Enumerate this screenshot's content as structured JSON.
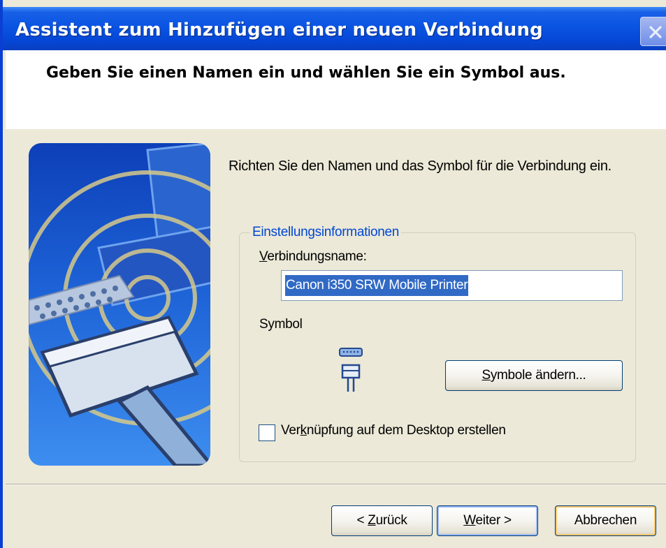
{
  "window": {
    "title": "Assistent zum Hinzufügen einer neuen Verbindung"
  },
  "header": {
    "title": "Geben Sie einen Namen ein und wählen Sie ein Symbol aus."
  },
  "main": {
    "intro": "Richten Sie den Namen und das Symbol für die Verbindung ein.",
    "group": {
      "legend": "Einstellungsinformationen",
      "name_label_mnemonic": "V",
      "name_label_rest": "erbindungsname:",
      "name_value": "Canon i350 SRW Mobile Printer",
      "symbol_label": "Symbol",
      "symbol_icon": "serial-port-connector-icon",
      "change_symbols_mnemonic": "S",
      "change_symbols_rest": "ymbole ändern...",
      "shortcut_label_pre": "Ver",
      "shortcut_label_mnemonic": "k",
      "shortcut_label_rest": "nüpfung auf dem Desktop erstellen",
      "shortcut_checked": false
    }
  },
  "footer": {
    "back_pre": "< ",
    "back_mnemonic": "Z",
    "back_rest": "urück",
    "next_mnemonic": "W",
    "next_rest": "eiter >",
    "cancel": "Abbrechen"
  },
  "colors": {
    "titlebar": "#0a54e3",
    "face": "#ece9d8",
    "selection": "#316ac5",
    "group_legend": "#0046d5"
  }
}
